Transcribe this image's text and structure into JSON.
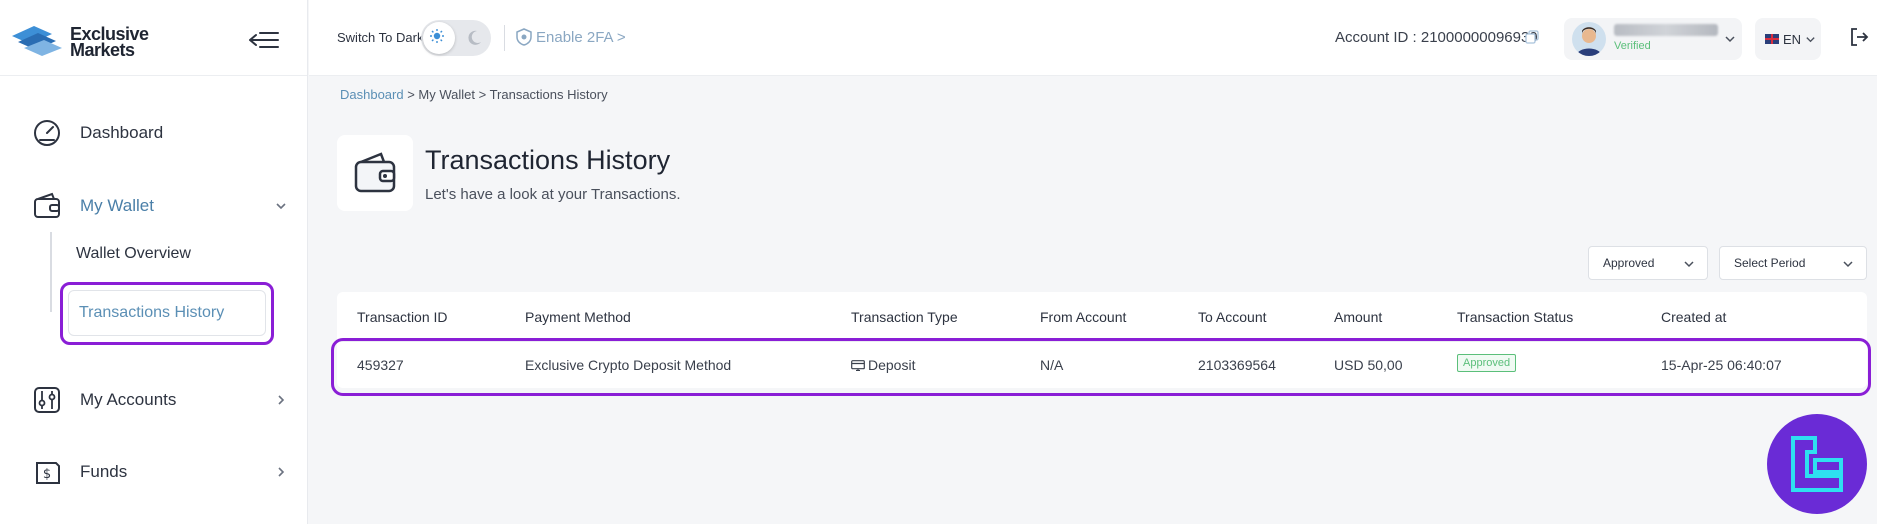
{
  "brand": {
    "line1": "Exclusive",
    "line2": "Markets"
  },
  "sidebar": {
    "items": [
      {
        "label": "Dashboard",
        "icon": "speedometer-icon"
      },
      {
        "label": "My Wallet",
        "icon": "wallet-icon",
        "expanded": true,
        "children": [
          {
            "label": "Wallet Overview"
          },
          {
            "label": "Transactions History",
            "active": true
          }
        ]
      },
      {
        "label": "My Accounts",
        "icon": "accounts-icon"
      },
      {
        "label": "Funds",
        "icon": "funds-icon"
      }
    ]
  },
  "header": {
    "theme_toggle_label": "Switch To Dark",
    "twofa_label": "Enable 2FA >",
    "account_id_label": "Account ID : 21000000096939",
    "user_status": "Verified",
    "language": "EN"
  },
  "breadcrumb": {
    "home": "Dashboard",
    "rest": " > My Wallet > Transactions History"
  },
  "page": {
    "title": "Transactions History",
    "subtitle": "Let's have a look at your Transactions."
  },
  "filters": {
    "status": "Approved",
    "period_placeholder": "Select Period"
  },
  "table": {
    "columns": [
      "Transaction ID",
      "Payment Method",
      "Transaction Type",
      "From Account",
      "To Account",
      "Amount",
      "Transaction Status",
      "Created at"
    ],
    "rows": [
      {
        "id": "459327",
        "method": "Exclusive Crypto Deposit Method",
        "type": "Deposit",
        "from": "N/A",
        "to": "2103369564",
        "amount": "USD 50,00",
        "status": "Approved",
        "created": "15-Apr-25 06:40:07"
      }
    ]
  },
  "colors": {
    "accent": "#5b8fb5",
    "highlight": "#8a1ed6",
    "success": "#5bbf7a"
  }
}
